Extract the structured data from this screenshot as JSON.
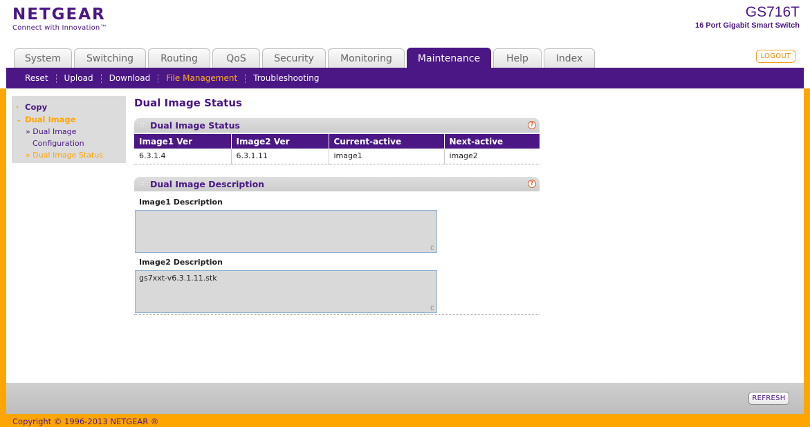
{
  "brand": {
    "logo": "NETGEAR",
    "tagline": "Connect with Innovation™",
    "model": "GS716T",
    "model_desc": "16 Port Gigabit Smart Switch"
  },
  "tabs": [
    {
      "label": "System",
      "active": false
    },
    {
      "label": "Switching",
      "active": false
    },
    {
      "label": "Routing",
      "active": false
    },
    {
      "label": "QoS",
      "active": false
    },
    {
      "label": "Security",
      "active": false
    },
    {
      "label": "Monitoring",
      "active": false
    },
    {
      "label": "Maintenance",
      "active": true
    },
    {
      "label": "Help",
      "active": false
    },
    {
      "label": "Index",
      "active": false
    }
  ],
  "logout_label": "LOGOUT",
  "subnav": [
    {
      "label": "Reset"
    },
    {
      "label": "Upload"
    },
    {
      "label": "Download"
    },
    {
      "label": "File Management"
    },
    {
      "label": "Troubleshooting"
    }
  ],
  "sidebar": {
    "copy": "Copy",
    "dual_image": "Dual Image",
    "sub1_line1": "» Dual Image",
    "sub1_line2": "Configuration",
    "sub2": "» Dual Image Status"
  },
  "page_title": "Dual Image Status",
  "status_section": {
    "title": "Dual Image Status",
    "headers": [
      "Image1 Ver",
      "Image2 Ver",
      "Current-active",
      "Next-active"
    ],
    "row": [
      "6.3.1.4",
      "6.3.1.11",
      "image1",
      "image2"
    ]
  },
  "desc_section": {
    "title": "Dual Image Description",
    "image1_label": "Image1 Description",
    "image1_value": "",
    "image2_label": "Image2 Description",
    "image2_value": "gs7xxt-v6.3.1.11.stk"
  },
  "help_glyph": "?",
  "refresh_label": "REFRESH",
  "copyright": "Copyright © 1996-2013 NETGEAR ®",
  "colors": {
    "purple": "#4a1785",
    "orange": "#ffa500"
  }
}
